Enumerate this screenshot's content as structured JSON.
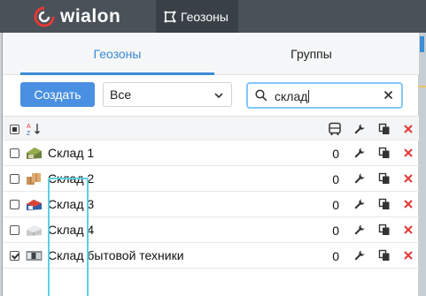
{
  "app": {
    "logo_text": "wialon",
    "module_label": "Геозоны"
  },
  "tabs": [
    {
      "label": "Геозоны",
      "active": true
    },
    {
      "label": "Группы",
      "active": false
    }
  ],
  "toolbar": {
    "create_label": "Создать",
    "filter_value": "Все",
    "search_value": "склад"
  },
  "list_header": {
    "select_all_state": "partial"
  },
  "rows": [
    {
      "name": "Склад 1",
      "count": "0",
      "checked": false,
      "thumb": "warehouse-green"
    },
    {
      "name": "Склад 2",
      "count": "0",
      "checked": false,
      "thumb": "boxes"
    },
    {
      "name": "Склад 3",
      "count": "0",
      "checked": false,
      "thumb": "warehouse-blue"
    },
    {
      "name": "Склад 4",
      "count": "0",
      "checked": false,
      "thumb": "warehouse-white"
    },
    {
      "name": "Склад бытовой техники",
      "count": "0",
      "checked": true,
      "thumb": "appliances"
    }
  ],
  "colors": {
    "accent": "#4a90e2",
    "topbar": "#4a5159",
    "delete": "#e53935",
    "highlight": "#5ecfe0"
  }
}
